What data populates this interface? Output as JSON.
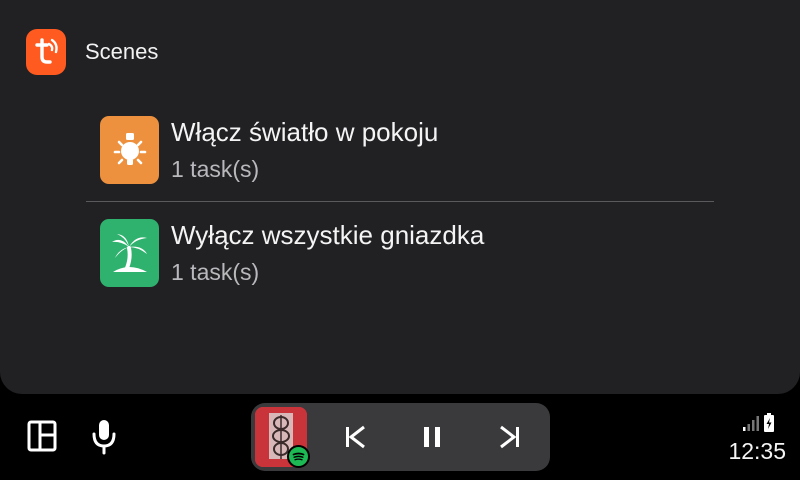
{
  "header": {
    "app_icon": "tuya-smart-logo-icon",
    "title": "Scenes",
    "brand_color": "#ff5a1f"
  },
  "scenes": [
    {
      "name": "Włącz światło w pokoju",
      "subtitle": "1 task(s)",
      "icon": "lightbulb-icon",
      "color": "#ee913e"
    },
    {
      "name": "Wyłącz wszystkie gniazdka",
      "subtitle": "1 task(s)",
      "icon": "palm-tree-icon",
      "color": "#2fb26e"
    }
  ],
  "bottom_bar": {
    "launcher_icon": "app-grid-icon",
    "mic_icon": "microphone-icon",
    "media": {
      "source_icon": "spotify-icon",
      "prev_icon": "skip-previous-icon",
      "play_pause_icon": "pause-icon",
      "next_icon": "skip-next-icon"
    },
    "status": {
      "signal_icon": "cell-signal-icon",
      "battery_icon": "battery-charging-icon",
      "time": "12:35"
    }
  }
}
